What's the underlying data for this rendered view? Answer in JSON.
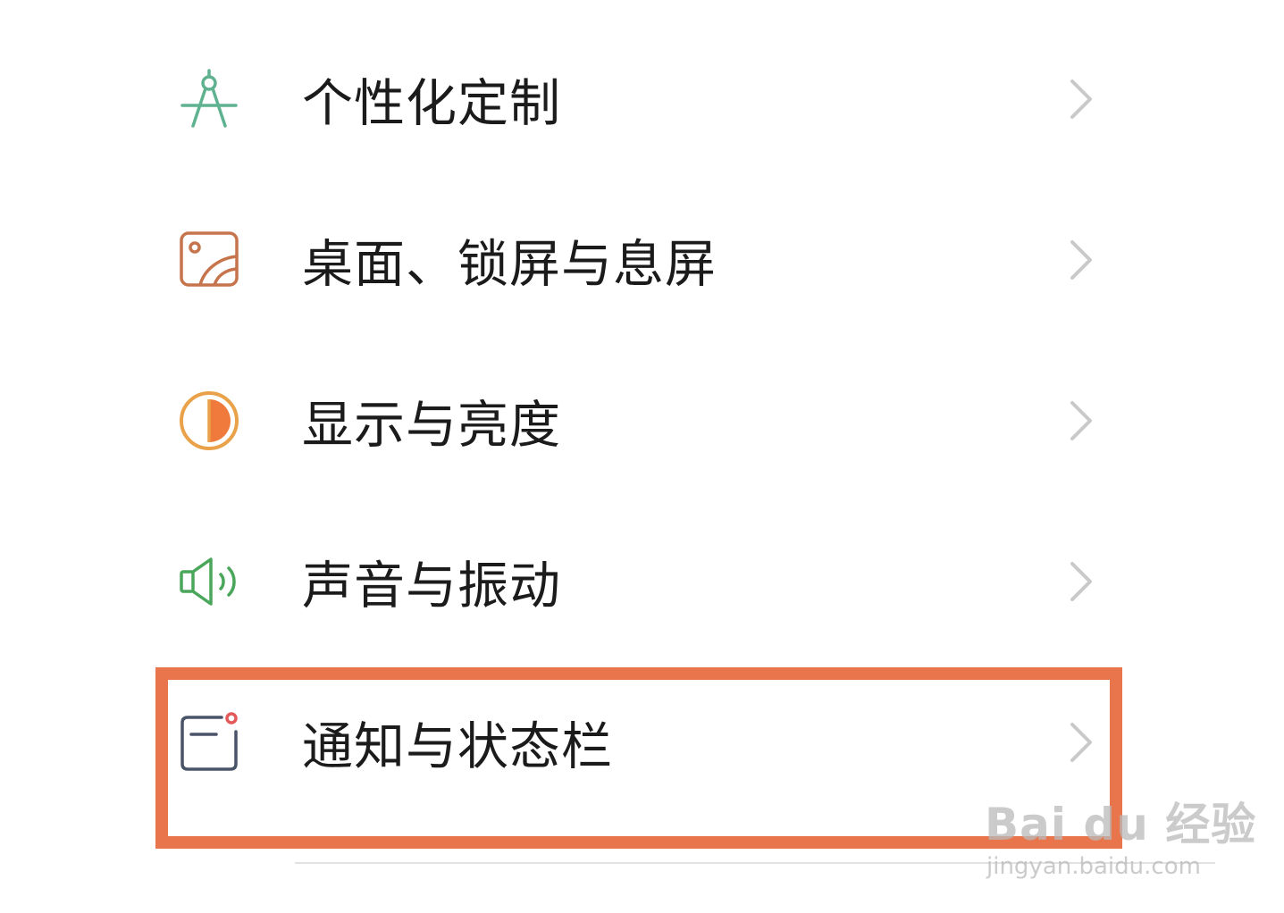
{
  "settings": {
    "items": [
      {
        "label": "个性化定制",
        "icon": "compass-icon",
        "color": "#5fb28f"
      },
      {
        "label": "桌面、锁屏与息屏",
        "icon": "wallpaper-icon",
        "color": "#c6744b"
      },
      {
        "label": "显示与亮度",
        "icon": "brightness-icon",
        "color": "#e9a24a"
      },
      {
        "label": "声音与振动",
        "icon": "speaker-icon",
        "color": "#4aa65a"
      },
      {
        "label": "通知与状态栏",
        "icon": "notification-icon",
        "color": "#4a5468"
      }
    ],
    "chevron_icon": "chevron-right-icon",
    "highlight_color": "#e8754c"
  },
  "watermark": {
    "logo": "Bai du 经验",
    "url": "jingyan.baidu.com"
  }
}
